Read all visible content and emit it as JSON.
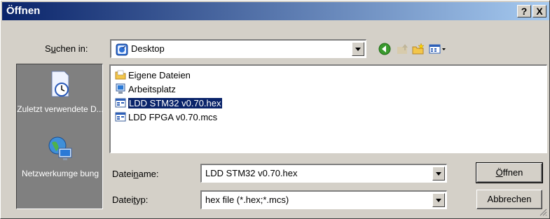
{
  "window": {
    "title": "Öffnen",
    "help_label": "?",
    "close_label": "X"
  },
  "look_in": {
    "label_pre": "S",
    "label_accel": "u",
    "label_post": "chen in:",
    "value": "Desktop"
  },
  "places": [
    {
      "label": "Zuletzt verwendete D...",
      "icon": "recent-icon"
    },
    {
      "label": "Netzwerkumge bung",
      "icon": "network-icon"
    }
  ],
  "files": [
    {
      "name": "Eigene Dateien",
      "icon": "folder-icon",
      "selected": false
    },
    {
      "name": "Arbeitsplatz",
      "icon": "computer-icon",
      "selected": false
    },
    {
      "name": "LDD  STM32  v0.70.hex",
      "icon": "file-icon",
      "selected": true
    },
    {
      "name": "LDD  FPGA  v0.70.mcs",
      "icon": "file-icon",
      "selected": false
    }
  ],
  "filename": {
    "label_pre": "Datei",
    "label_accel": "n",
    "label_post": "ame:",
    "value": "LDD  STM32  v0.70.hex"
  },
  "filetype": {
    "label_pre": "Datei",
    "label_accel": "t",
    "label_post": "yp:",
    "value": "hex file (*.hex;*.mcs)"
  },
  "buttons": {
    "open_accel": "Ö",
    "open_rest": "ffnen",
    "cancel": "Abbrechen"
  },
  "colors": {
    "title_start": "#0a246a",
    "title_end": "#a6caf0",
    "selection": "#0a246a",
    "face": "#d4d0c8"
  }
}
